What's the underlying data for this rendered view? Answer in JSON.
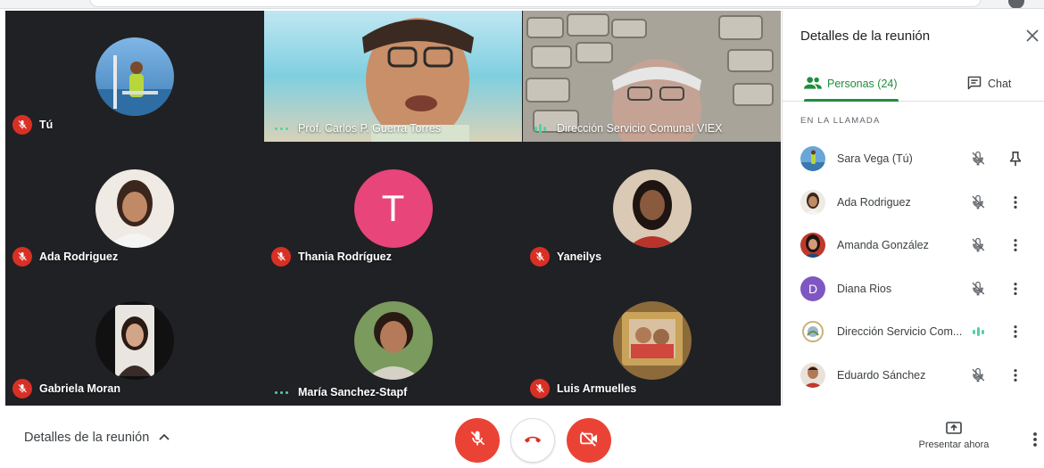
{
  "panel": {
    "title": "Detalles de la reunión",
    "tab_people": "Personas (24)",
    "tab_chat": "Chat",
    "section_label": "EN LA LLAMADA",
    "people": [
      {
        "name": "Sara Vega (Tú)",
        "avatar_type": "photo",
        "mic": "muted",
        "action": "pin-icon"
      },
      {
        "name": "Ada Rodriguez",
        "avatar_type": "photo",
        "mic": "muted",
        "action": "more-vert-icon"
      },
      {
        "name": "Amanda González",
        "avatar_type": "photo",
        "mic": "muted",
        "action": "more-vert-icon"
      },
      {
        "name": "Diana Rios",
        "avatar_type": "letter",
        "letter": "D",
        "mic": "muted",
        "action": "more-vert-icon"
      },
      {
        "name": "Dirección Servicio Com...",
        "avatar_type": "photo",
        "mic": "speaking",
        "action": "more-vert-icon"
      },
      {
        "name": "Eduardo Sánchez",
        "avatar_type": "photo",
        "mic": "muted",
        "action": "more-vert-icon"
      }
    ]
  },
  "tiles": [
    {
      "name": "Tú",
      "type": "avatar-photo",
      "status": "muted"
    },
    {
      "name": "Prof. Carlos P. Guerra Torres",
      "type": "video",
      "status": "talking-dots"
    },
    {
      "name": "Dirección Servicio Comunal VIEX",
      "type": "video",
      "status": "talking-bars"
    },
    {
      "name": "Ada Rodriguez",
      "type": "avatar-photo",
      "status": "muted"
    },
    {
      "name": "Thania Rodríguez",
      "type": "avatar-letter",
      "letter": "T",
      "status": "muted"
    },
    {
      "name": "Yaneilys",
      "type": "avatar-photo",
      "status": "muted"
    },
    {
      "name": "Gabriela Moran",
      "type": "avatar-photo",
      "status": "muted"
    },
    {
      "name": "María Sanchez-Stapf",
      "type": "avatar-photo",
      "status": "talking-dots"
    },
    {
      "name": "Luis Armuelles",
      "type": "avatar-photo",
      "status": "muted"
    }
  ],
  "bottom": {
    "meeting_details": "Detalles de la reunión",
    "present_now": "Presentar ahora"
  },
  "colors": {
    "grid_bg": "#202124",
    "mute_red": "#ea4335",
    "accent_green": "#1e8e3e",
    "speaking_teal": "#4fd1a5",
    "letter_pink": "#e8457a",
    "letter_purple": "#7e57c2"
  }
}
